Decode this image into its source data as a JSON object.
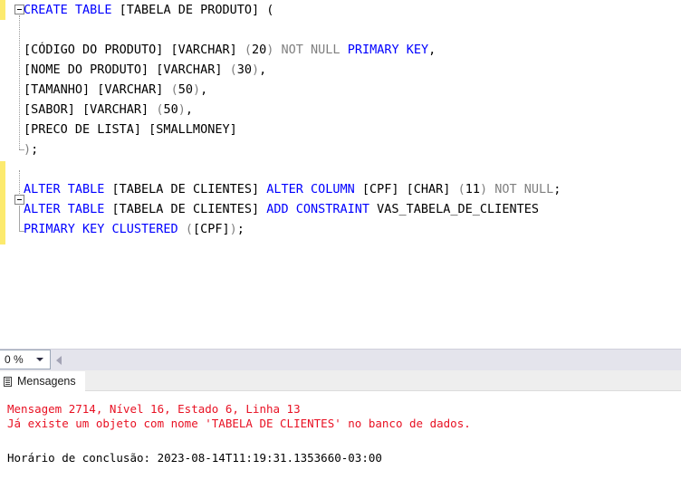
{
  "editor": {
    "zoom_value": "0 %",
    "code_lines": [
      {
        "indent": 0,
        "tokens": [
          {
            "t": "CREATE TABLE",
            "c": "kw"
          },
          {
            "t": " [TABELA DE PRODUTO] (",
            "c": "plain"
          }
        ]
      },
      {
        "indent": 0,
        "tokens": []
      },
      {
        "indent": 0,
        "tokens": [
          {
            "t": "[CÓDIGO DO PRODUTO] [VARCHAR] ",
            "c": "plain"
          },
          {
            "t": "(",
            "c": "gray"
          },
          {
            "t": "20",
            "c": "plain"
          },
          {
            "t": ")",
            "c": "gray"
          },
          {
            "t": " ",
            "c": "plain"
          },
          {
            "t": "NOT NULL",
            "c": "gray"
          },
          {
            "t": " ",
            "c": "plain"
          },
          {
            "t": "PRIMARY KEY",
            "c": "kw"
          },
          {
            "t": ",",
            "c": "plain"
          }
        ]
      },
      {
        "indent": 0,
        "tokens": [
          {
            "t": "[NOME DO PRODUTO] [VARCHAR] ",
            "c": "plain"
          },
          {
            "t": "(",
            "c": "gray"
          },
          {
            "t": "30",
            "c": "plain"
          },
          {
            "t": ")",
            "c": "gray"
          },
          {
            "t": ",",
            "c": "plain"
          }
        ]
      },
      {
        "indent": 0,
        "tokens": [
          {
            "t": "[TAMANHO] [VARCHAR] ",
            "c": "plain"
          },
          {
            "t": "(",
            "c": "gray"
          },
          {
            "t": "50",
            "c": "plain"
          },
          {
            "t": ")",
            "c": "gray"
          },
          {
            "t": ",",
            "c": "plain"
          }
        ]
      },
      {
        "indent": 0,
        "tokens": [
          {
            "t": "[SABOR] [VARCHAR] ",
            "c": "plain"
          },
          {
            "t": "(",
            "c": "gray"
          },
          {
            "t": "50",
            "c": "plain"
          },
          {
            "t": ")",
            "c": "gray"
          },
          {
            "t": ",",
            "c": "plain"
          }
        ]
      },
      {
        "indent": 0,
        "tokens": [
          {
            "t": "[PRECO DE LISTA] [SMALLMONEY]",
            "c": "plain"
          }
        ]
      },
      {
        "indent": 0,
        "tokens": [
          {
            "t": ")",
            "c": "gray"
          },
          {
            "t": ";",
            "c": "plain"
          }
        ]
      },
      {
        "indent": 0,
        "tokens": []
      },
      {
        "indent": 0,
        "tokens": [
          {
            "t": "ALTER TABLE",
            "c": "kw"
          },
          {
            "t": " [TABELA DE CLIENTES] ",
            "c": "plain"
          },
          {
            "t": "ALTER COLUMN",
            "c": "kw"
          },
          {
            "t": " [CPF] [CHAR] ",
            "c": "plain"
          },
          {
            "t": "(",
            "c": "gray"
          },
          {
            "t": "11",
            "c": "plain"
          },
          {
            "t": ")",
            "c": "gray"
          },
          {
            "t": " ",
            "c": "plain"
          },
          {
            "t": "NOT NULL",
            "c": "gray"
          },
          {
            "t": ";",
            "c": "plain"
          }
        ]
      },
      {
        "indent": 0,
        "tokens": [
          {
            "t": "ALTER TABLE",
            "c": "kw"
          },
          {
            "t": " [TABELA DE CLIENTES] ",
            "c": "plain"
          },
          {
            "t": "ADD CONSTRAINT",
            "c": "kw"
          },
          {
            "t": " VAS_TABELA_DE_CLIENTES",
            "c": "plain"
          }
        ]
      },
      {
        "indent": 0,
        "tokens": [
          {
            "t": "PRIMARY KEY CLUSTERED",
            "c": "kw"
          },
          {
            "t": " ",
            "c": "plain"
          },
          {
            "t": "(",
            "c": "gray"
          },
          {
            "t": "[CPF]",
            "c": "plain"
          },
          {
            "t": ")",
            "c": "gray"
          },
          {
            "t": ";",
            "c": "plain"
          }
        ]
      }
    ]
  },
  "results": {
    "tab_label": "Mensagens",
    "message_lines": [
      {
        "text": "Mensagem 2714, Nível 16, Estado 6, Linha 13",
        "kind": "err"
      },
      {
        "text": "Já existe um objeto com nome 'TABELA DE CLIENTES' no banco de dados.",
        "kind": "err"
      },
      {
        "text": "",
        "kind": "err"
      },
      {
        "text": "Horário de conclusão: 2023-08-14T11:19:31.1353660-03:00",
        "kind": "info"
      }
    ]
  },
  "colors": {
    "keyword": "#0000ff",
    "identifier": "#000000",
    "muted": "#808080",
    "error": "#e81123",
    "change_bar": "#fcea6e"
  }
}
